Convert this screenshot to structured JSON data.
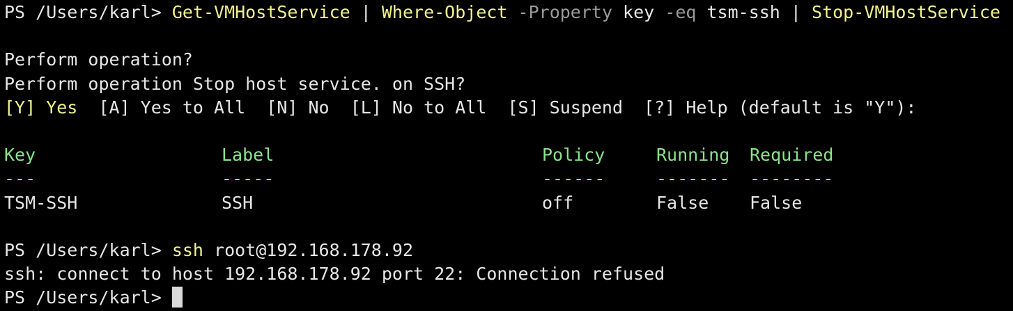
{
  "session1": {
    "prompt": "PS /Users/karl> ",
    "cmd1": "Get-VMHostService",
    "pipe1": " | ",
    "cmd2": "Where-Object",
    "param1": " -Property",
    "arg1": " key",
    "param2": " -eq",
    "arg2": " tsm-ssh",
    "pipe2": " | ",
    "cmd3": "Stop-VMHostService"
  },
  "confirm": {
    "title": "Perform operation?",
    "message": "Perform operation Stop host service. on SSH?",
    "option_yes": "[Y] Yes",
    "option_yes_all": "  [A] Yes to All  [N] No  [L] No to All  [S] Suspend",
    "help": "  [?] Help (default is \"Y\"):"
  },
  "table": {
    "headers": [
      "Key",
      "Label",
      "Policy",
      "Running",
      "Required"
    ],
    "underlines": [
      "---",
      "-----",
      "------",
      "-------",
      "--------"
    ],
    "rows": [
      [
        "TSM-SSH",
        "SSH",
        "off",
        "False",
        "False"
      ]
    ]
  },
  "session2": {
    "prompt": "PS /Users/karl> ",
    "cmd": "ssh",
    "arg": " root@192.168.178.92",
    "output": "ssh: connect to host 192.168.178.92 port 22: Connection refused"
  },
  "session3": {
    "prompt": "PS /Users/karl> "
  },
  "colors": {
    "background": "#000000",
    "text": "#e6e6e6",
    "command": "#f2f28f",
    "parameter": "#9a9a9a",
    "header": "#8be38b"
  }
}
